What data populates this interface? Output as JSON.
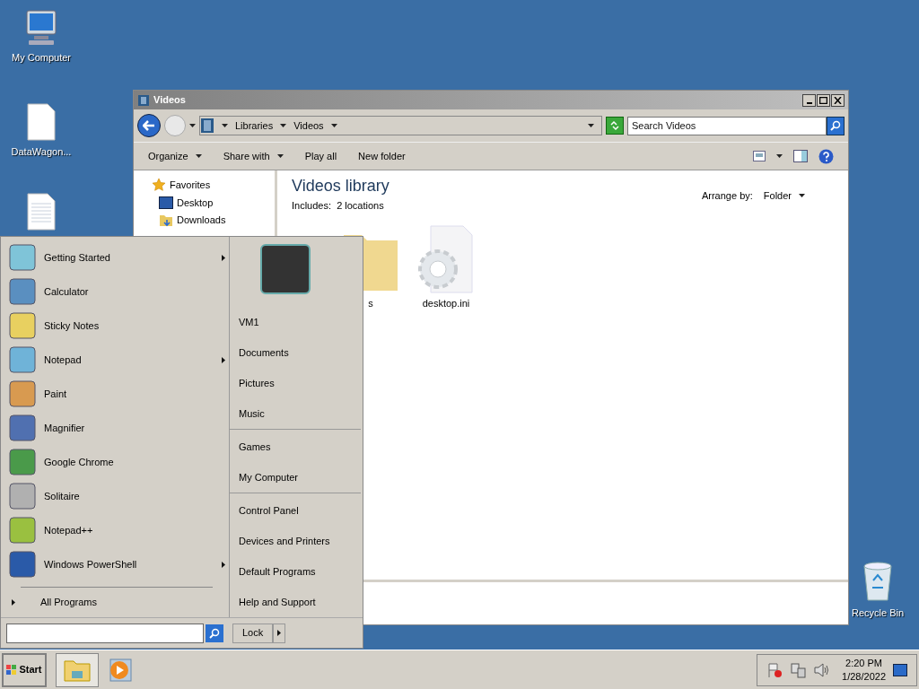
{
  "desktop_icons": [
    {
      "label": "My Computer",
      "kind": "computer"
    },
    {
      "label": "DataWagon...",
      "kind": "file"
    },
    {
      "kind": "file"
    },
    {
      "label": "Recycle Bin",
      "kind": "recycle"
    }
  ],
  "window": {
    "title": "Videos",
    "breadcrumbs": [
      "Libraries",
      "Videos"
    ],
    "search_placeholder": "Search Videos",
    "commands": [
      {
        "label": "Organize",
        "dropdown": true
      },
      {
        "label": "Share with",
        "dropdown": true
      },
      {
        "label": "Play all",
        "dropdown": false
      },
      {
        "label": "New folder",
        "dropdown": false
      }
    ],
    "nav": {
      "header": "Favorites",
      "items": [
        {
          "label": "Desktop",
          "kind": "desktop"
        },
        {
          "label": "Downloads",
          "kind": "downloads"
        }
      ]
    },
    "library_title": "Videos library",
    "includes": "Includes:  2 locations",
    "arrange_label": "Arrange by:",
    "arrange_value": "Folder",
    "files": [
      {
        "name": "s",
        "kind": "folder"
      },
      {
        "name": "desktop.ini",
        "kind": "settings"
      }
    ]
  },
  "start_menu": {
    "programs": [
      {
        "label": "Getting Started",
        "submenu": true
      },
      {
        "label": "Calculator",
        "submenu": false
      },
      {
        "label": "Sticky Notes",
        "submenu": false
      },
      {
        "label": "Notepad",
        "submenu": true
      },
      {
        "label": "Paint",
        "submenu": false
      },
      {
        "label": "Magnifier",
        "submenu": false
      },
      {
        "label": "Google Chrome",
        "submenu": false
      },
      {
        "label": "Solitaire",
        "submenu": false
      },
      {
        "label": "Notepad++",
        "submenu": false
      },
      {
        "label": "Windows PowerShell",
        "submenu": true
      }
    ],
    "all_programs": "All Programs",
    "places": [
      [
        "VM1",
        "Documents",
        "Pictures",
        "Music"
      ],
      [
        "Games",
        "My Computer"
      ],
      [
        "Control Panel",
        "Devices and Printers",
        "Default Programs",
        "Help and Support"
      ]
    ],
    "lock": "Lock"
  },
  "taskbar": {
    "start": "Start",
    "time": "2:20 PM",
    "date": "1/28/2022"
  }
}
